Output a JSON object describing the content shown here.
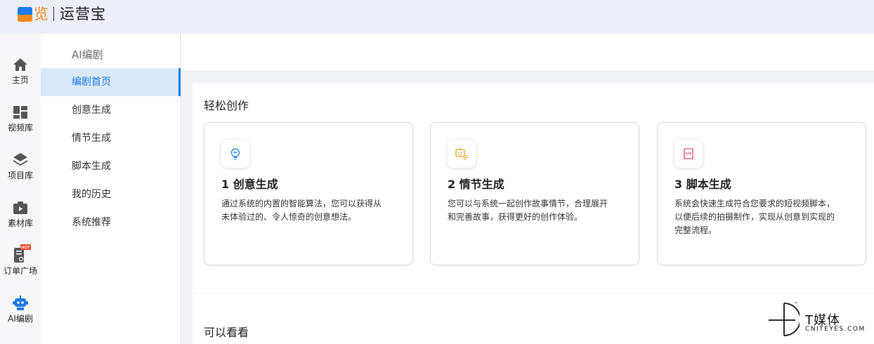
{
  "brand": {
    "logo_char": "览",
    "name": "运营宝",
    "colors": {
      "blue": "#1a7bf2",
      "orange": "#f58a1c"
    }
  },
  "rail": {
    "items": [
      {
        "label": "主页",
        "icon": "home-icon"
      },
      {
        "label": "视频库",
        "icon": "video-library-icon"
      },
      {
        "label": "项目库",
        "icon": "layers-icon"
      },
      {
        "label": "素材库",
        "icon": "material-box-icon"
      },
      {
        "label": "订单广场",
        "icon": "order-icon",
        "badge": "HOT"
      },
      {
        "label": "AI编剧",
        "icon": "robot-icon",
        "active": true
      }
    ]
  },
  "submenu": {
    "title": "AI编剧",
    "items": [
      {
        "label": "编剧首页",
        "active": true
      },
      {
        "label": "创意生成"
      },
      {
        "label": "情节生成"
      },
      {
        "label": "脚本生成"
      },
      {
        "label": "我的历史"
      },
      {
        "label": "系统推荐"
      }
    ]
  },
  "main": {
    "section_title": "轻松创作",
    "cards": [
      {
        "title": "1 创意生成",
        "desc": "通过系统的内置的智能算法，您可以获得从未体验过的、令人惊奇的创意想法。",
        "icon": "lightbulb-icon",
        "icon_color": "#2b8be6"
      },
      {
        "title": "2 情节生成",
        "desc": "您可以与系统一起创作故事情节，合理展开和完善故事，获得更好的创作体验。",
        "icon": "plot-icon",
        "icon_color": "#f0a32a"
      },
      {
        "title": "3 脚本生成",
        "desc": "系统会快速生成符合您要求的短视频脚本，以便后续的拍摄制作，实现从创意到实现的完整流程。",
        "icon": "code-script-icon",
        "icon_color": "#e0457b"
      }
    ],
    "section2_title": "可以看看"
  },
  "watermark": {
    "text": "T媒体",
    "sub": "CNITEYES.COM",
    "tm": "™"
  }
}
